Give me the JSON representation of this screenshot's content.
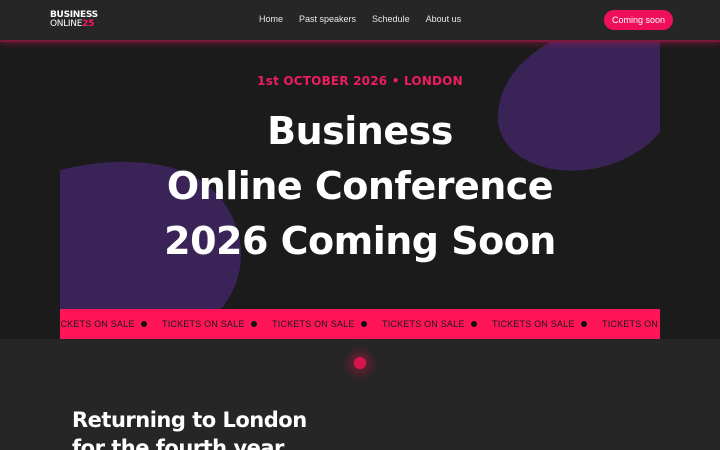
{
  "header": {
    "logo": {
      "line1": "BUSINESS",
      "line2_text": "ONLINE",
      "line2_year": "25"
    },
    "nav": [
      {
        "label": "Home"
      },
      {
        "label": "Past speakers"
      },
      {
        "label": "Schedule"
      },
      {
        "label": "About us"
      }
    ],
    "cta_label": "Coming soon"
  },
  "hero": {
    "date_location": "1st OCTOBER 2026 • LONDON",
    "title_lines": [
      "Business",
      "Online Conference",
      "2026 Coming Soon"
    ]
  },
  "ticker": {
    "item_label": "TICKETS ON SALE"
  },
  "section": {
    "heading_lines": [
      "Returning to London",
      "for the fourth year"
    ]
  },
  "colors": {
    "accent": "#ef0f5c",
    "background": "#262626",
    "hero_background": "#1b1b1b",
    "blob": "#3a2356"
  },
  "icons": {
    "ticker_separator": "dot-icon",
    "section_marker": "glow-dot-icon"
  }
}
